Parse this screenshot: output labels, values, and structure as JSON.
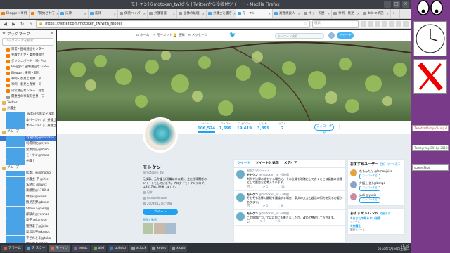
{
  "window": {
    "title": "モトケン(@motoken_tw)さん | Twitterから投稿付ツイート - Mozilla Firefox",
    "buttons": [
      "_",
      "□",
      "×"
    ]
  },
  "tabs": [
    {
      "label": "Blogger: 事例",
      "color": "#f57d00"
    },
    {
      "label": "「開始されて",
      "color": "#f57d00"
    },
    {
      "label": "法律",
      "color": "#4ba3e7"
    },
    {
      "label": "法律",
      "color": "#4ba3e7"
    },
    {
      "label": "価値ハイパ",
      "color": "#9a9a9a"
    },
    {
      "label": "弁護官書",
      "color": "#9a9a9a"
    },
    {
      "label": "画像の処理",
      "color": "#9a9a9a"
    },
    {
      "label": "弁護士と書き",
      "color": "#4ba3e7"
    },
    {
      "label": "モトケン",
      "color": "#4ba3e7",
      "active": true
    },
    {
      "label": "高野規良人",
      "color": "#4ba3e7"
    },
    {
      "label": "ネットの歴",
      "color": "#9a9a9a"
    },
    {
      "label": "事例・意見",
      "color": "#9a9a9a"
    },
    {
      "label": "ヒヒつ新記",
      "color": "#9a9a9a"
    }
  ],
  "navbar": {
    "url": "https://twitter.com/motoken_tw/with_replies",
    "search_placeholder": "検索"
  },
  "sidebar": {
    "title": "ブックマーク",
    "search_placeholder": "ブックマークを検索",
    "items": [
      {
        "label": "日常・田嶋遠征センター",
        "type": "bl"
      },
      {
        "label": "弁護士と世・業務機能付",
        "type": "bl"
      },
      {
        "label": "ダッシュボード - My Pro",
        "type": "bl"
      },
      {
        "label": "Blogger: 田嶋遠征センター",
        "type": "bl"
      },
      {
        "label": "Blogger: 事例・意見",
        "type": "bl"
      },
      {
        "label": "事例・意見と考察・所",
        "type": "bl"
      },
      {
        "label": "事例・意見と考察・同",
        "type": "bl"
      },
      {
        "label": "日常遠征センター・総合",
        "type": "bl"
      },
      {
        "label": "関連性の事実の世界・ブ",
        "type": "pg"
      },
      {
        "label": "Twitter",
        "type": "folder"
      },
      {
        "label": "弁護士",
        "type": "folder"
      },
      {
        "label": "Twitterの真実を検索",
        "type": "tw"
      },
      {
        "label": "本ページ(くま) 弁護士",
        "type": "tw"
      },
      {
        "label": "本ページ(くま) 弁護士",
        "type": "tw"
      },
      {
        "label": "グループ",
        "type": "folder"
      },
      {
        "label": "羽場保佐@motoken",
        "type": "tw",
        "selected": true
      },
      {
        "label": "羽場保佐@nyan",
        "type": "tw"
      },
      {
        "label": "金澤典弘@mishi",
        "type": "tw"
      },
      {
        "label": "モトケン@moto",
        "type": "tw"
      },
      {
        "label": "弁護士",
        "type": "tw"
      },
      {
        "label": "グループ",
        "type": "folder"
      },
      {
        "label": "松本江米@motko",
        "type": "tw"
      },
      {
        "label": "弁護士 平 @2ss",
        "type": "tw"
      },
      {
        "label": "法務官 @nwyz",
        "type": "tw"
      },
      {
        "label": "後藤勝@1700-d",
        "type": "tw"
      },
      {
        "label": "林新日@weew",
        "type": "tw"
      },
      {
        "label": "鶴見吉野@bnnc",
        "type": "tw"
      },
      {
        "label": "Shoko Egawa@",
        "type": "tw"
      },
      {
        "label": "ぽぽた@yonhaa",
        "type": "tw"
      },
      {
        "label": "高平 @kaneko",
        "type": "tw"
      },
      {
        "label": "猪野泰子@jjaka",
        "type": "tw"
      },
      {
        "label": "高島昌平@kgcoc",
        "type": "tw"
      },
      {
        "label": "平ざれとま@taka",
        "type": "tw"
      },
      {
        "label": "中田大進@rkaz",
        "type": "tw"
      }
    ]
  },
  "twitter": {
    "nav": {
      "home": "ホーム",
      "moments": "モーメント",
      "notifications": "通知",
      "messages": "メッセージ",
      "search_placeholder": "キーワード検索",
      "tweet_button": "ツイート"
    },
    "stats": [
      {
        "label": "ツイート",
        "value": "106,524"
      },
      {
        "label": "フォロー",
        "value": "1,699"
      },
      {
        "label": "フォロワー",
        "value": "19,419"
      },
      {
        "label": "いいね",
        "value": "3,399"
      },
      {
        "label": "リスト",
        "value": "2"
      }
    ],
    "follow_button": "フォローする",
    "profile": {
      "name": "モトケン",
      "handle": "@motoken_tw",
      "bio": "元検事、元弁護士(現職は非公開)、主に法律関係のツイートをしています。ブログ『モトケンブログ』は2017年に閉鎖しました。",
      "location": "日本",
      "link": "facebook.com",
      "joined": "2009年12月に登録",
      "tweet_to": "ツイート",
      "photos_label": "画像と動画"
    },
    "timeline": {
      "tabs": [
        "ツイート",
        "ツイートと返信",
        "メディア"
      ],
      "tweets": [
        {
          "rt": "固定されたツイート",
          "name": "モトケン",
          "handle": "@motoken_tw · 6時間",
          "text": "判例や法律の話をする場合に、その立場を明確にしておくことは議論の前提として重要だと考えています。",
          "actions": [
            "2",
            "5",
            "12"
          ]
        },
        {
          "rt": "",
          "name": "モトケン",
          "handle": "@motoken_tw · 7時間",
          "text": "そもそも法律の解釈を議論する場合、条文の文言と趣旨の両方を見る必要があります。",
          "actions": [
            "1",
            "3",
            "8"
          ]
        },
        {
          "rt": "",
          "name": "モトケン",
          "handle": "@motoken_tw · 8時間",
          "text": "この問題については以前にも書きましたが、改めて整理しておきます。",
          "actions": [
            "",
            "2",
            "6"
          ]
        }
      ]
    },
    "suggestions": {
      "title": "おすすめユーザー",
      "refresh": "更新 · すべて表示",
      "follow": "フォローする",
      "users": [
        {
          "name": "れもんたん @lemonjuice",
          "color": "#e6a23c"
        },
        {
          "name": "弁護士(仮) @bengo",
          "color": "#8aa4c8"
        },
        {
          "name": "yuki @yukio",
          "color": "#c98aa3"
        }
      ]
    },
    "trends": {
      "title": "おすすめトレンド",
      "change": "変更する",
      "items": [
        {
          "tag": "#あなたの知らない法律",
          "sub": "ツイート"
        },
        {
          "tag": "#弁護士",
          "sub": "関連ツイート"
        }
      ]
    }
  },
  "taskbar": {
    "items": [
      {
        "label": "アラーム",
        "color": "#d9534f"
      },
      {
        "label": "ス スクー",
        "color": "#4ba3e7"
      },
      {
        "label": "モトケン",
        "color": "#e66b2e",
        "active": true
      },
      {
        "label": "emac",
        "color": "#8a5fb0"
      },
      {
        "label": "ab6",
        "color": "#6aa84f"
      },
      {
        "label": "gphoto",
        "color": "#3c78d8"
      },
      {
        "label": "xclock",
        "color": "#999999"
      },
      {
        "label": "xeyes",
        "color": "#999999"
      },
      {
        "label": "xlogo",
        "color": "#999999"
      }
    ],
    "time": "11:16",
    "date": "2018年7月26日土曜日"
  },
  "desktop": {
    "notes": [
      {
        "text": "Tweet-add-mysql-unp.rl",
        "color": "#c0392b"
      },
      {
        "text": "Tamoyr-myl2018p-28181",
        "color": "#2e7d32"
      },
      {
        "text": "screenShot",
        "color": "#333333"
      }
    ]
  }
}
